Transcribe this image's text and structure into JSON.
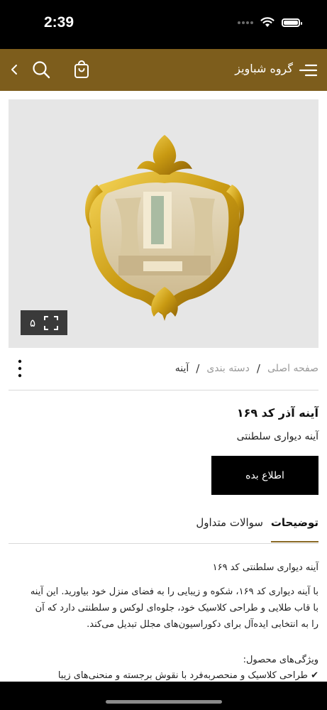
{
  "status_bar": {
    "time": "2:39"
  },
  "header": {
    "title": "گروه شباویز",
    "icons": [
      "back-chevron-icon",
      "search-icon",
      "shopping-bag-icon",
      "hamburger-menu-icon"
    ],
    "color": "#7d5d1c"
  },
  "gallery": {
    "image_count": "۵",
    "expand_icon": "fullscreen-icon"
  },
  "breadcrumb": {
    "home": "صفحه اصلی",
    "category": "دسته بندی",
    "current": "آینه",
    "separator": "/"
  },
  "product": {
    "title": "آینه آذر کد ۱۶۹",
    "subtitle": "آینه دیواری سلطنتی",
    "notify_button": "اطلاع بده"
  },
  "tabs": {
    "description": "توضیحات",
    "faq": "سوالات متداول",
    "active": "توضیحات"
  },
  "description": {
    "heading": "آینه دیواری سلطنتی کد ۱۶۹",
    "body": "با آینه دیواری کد ۱۶۹، شکوه و زیبایی را به فضای منزل خود بیاورید. این آینه با قاب طلایی و طراحی کلاسیک خود، جلوه‌ای لوکس و سلطنتی دارد که آن را به انتخابی ایده‌آل برای دکوراسیون‌های مجلل تبدیل می‌کند.",
    "features_heading": "ویژگی‌های محصول:",
    "feature_1": "✔ طراحی کلاسیک و منحصربه‌فرد با نقوش برجسته و منحنی‌های زیبا"
  },
  "colors": {
    "accent": "#8a6a26",
    "header": "#7d5d1c",
    "button": "#000000"
  }
}
